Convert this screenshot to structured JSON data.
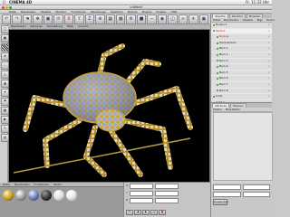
{
  "mac_menubar": {
    "app_name": "CINEMA 4D",
    "clock": "Fr. 11:32 Uhr"
  },
  "window": {
    "title": "untitled"
  },
  "main_menu": [
    "Datei",
    "Bearbeiten",
    "Objekte",
    "Struktur",
    "Funktionen",
    "Werkzeuge",
    "Selektion",
    "Module",
    "Plugins",
    "Fenster",
    "Hilfe"
  ],
  "viewport_menu": [
    "Bearbeiten",
    "Kameras",
    "Darstellung",
    "Filter",
    "Ansicht"
  ],
  "material_menu": [
    "Datei",
    "Bearbeiten",
    "Funktionen",
    "Textur"
  ],
  "object_manager": {
    "tabs": [
      "Objekte",
      "Struktur",
      "Browser"
    ],
    "menu": [
      "Datei",
      "Bearbeiten",
      "Objekte",
      "Tags",
      "Textur"
    ],
    "items": [
      {
        "label": "Boden.1",
        "red": false
      },
      {
        "label": "Spinne",
        "red": true
      },
      {
        "label": "Korpus",
        "red": true
      },
      {
        "label": "Spinnenbein",
        "red": false
      },
      {
        "label": "Bein 1",
        "red": false
      },
      {
        "label": "Bein 2",
        "red": false
      },
      {
        "label": "Bein 3",
        "red": false
      },
      {
        "label": "Bein 4",
        "red": false
      },
      {
        "label": "Bein 5",
        "red": false
      },
      {
        "label": "Bein 6",
        "red": false
      },
      {
        "label": "Bein 7",
        "red": false
      },
      {
        "label": "Bein 8",
        "red": false
      },
      {
        "label": "Licht",
        "red": false
      },
      {
        "label": "Licht.1",
        "red": false
      },
      {
        "label": "Szene",
        "red": false
      },
      {
        "label": "Hintergrund",
        "red": false
      }
    ]
  },
  "attribute_manager": {
    "tabs": [
      "Attribute",
      "Ebenen"
    ],
    "menu": [
      "Modus",
      "Bearbeiten"
    ]
  },
  "coords": {
    "labels": [
      "X",
      "Y",
      "Z"
    ]
  },
  "right_lower": {
    "apply_label": "Anwenden"
  },
  "colors": {
    "viewport_bg": "#000000",
    "gold": "#c8a030",
    "gem": "#8c9cc8"
  }
}
